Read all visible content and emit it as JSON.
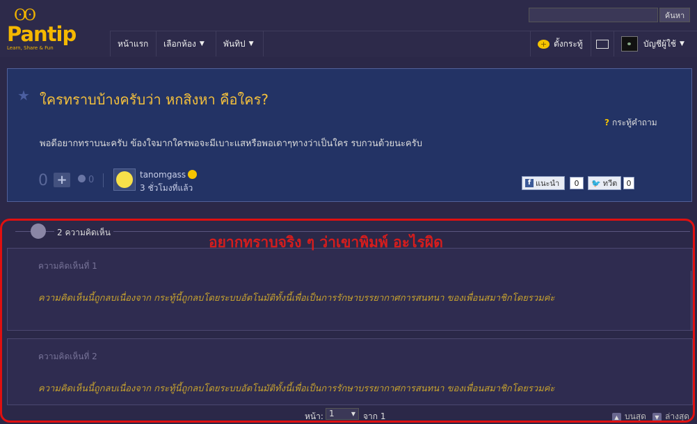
{
  "header": {
    "logo_text": "Pantip",
    "logo_tagline": "Learn, Share & Fun",
    "search_placeholder": "",
    "search_button": "ค้นหา",
    "nav": [
      "หน้าแรก",
      "เลือกห้อง",
      "พันทิป"
    ],
    "new_topic": "ตั้งกระทู้",
    "account": "บัญชีผู้ใช้"
  },
  "topic": {
    "title": "ใครทราบบ้างครับว่า หกสิงหา คือใคร?",
    "type_label": "กระทู้คำถาม",
    "body": "พอดีอยากทราบนะครับ ข้องใจมากใครพอจะมีเบาะแสหรือพอเดาๆทางว่าเป็นใคร รบกวนด้วยนะครับ",
    "votes": "0",
    "emotions": "0",
    "username": "tanomgass",
    "time": "3 ชั่วโมงที่แล้ว",
    "fb_label": "แนะนำ",
    "fb_count": "0",
    "tw_label": "ทวีต",
    "tw_count": "0"
  },
  "comments": {
    "count_label": "2 ความคิดเห็น",
    "annotation": "อยากทราบจริง ๆ ว่าเขาพิมพ์ อะไรผิด",
    "items": [
      {
        "label": "ความคิดเห็นที่ 1",
        "text": "ความคิดเห็นนี้ถูกลบเนื่องจาก กระทู้นี้ถูกลบโดยระบบอัตโนมัติทั้งนี้เพื่อเป็นการรักษาบรรยากาศการสนทนา ของเพื่อนสมาชิกโดยรวมค่ะ"
      },
      {
        "label": "ความคิดเห็นที่ 2",
        "text": "ความคิดเห็นนี้ถูกลบเนื่องจาก กระทู้นี้ถูกลบโดยระบบอัตโนมัติทั้งนี้เพื่อเป็นการรักษาบรรยากาศการสนทนา ของเพื่อนสมาชิกโดยรวมค่ะ"
      }
    ]
  },
  "pager": {
    "page_label": "หน้า:",
    "current": "1",
    "of_label": "จาก 1",
    "top_label": "บนสุด",
    "bottom_label": "ล่างสุด"
  }
}
